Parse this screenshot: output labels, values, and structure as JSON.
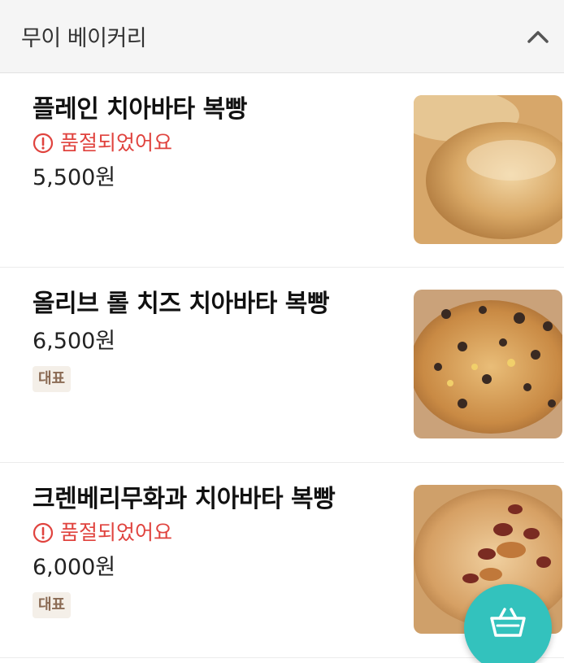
{
  "section": {
    "title": "무이 베이커리"
  },
  "items": [
    {
      "name": "플레인 치아바타 복빵",
      "soldout_text": "품절되었어요",
      "price": "5,500원"
    },
    {
      "name": "올리브 롤 치즈 치아바타 복빵",
      "price": "6,500원",
      "badge": "대표"
    },
    {
      "name": "크렌베리무화과 치아바타 복빵",
      "soldout_text": "품절되었어요",
      "price": "6,000원",
      "badge": "대표"
    }
  ],
  "colors": {
    "soldout": "#e0433e",
    "fab": "#33c2bd",
    "badge_bg": "#f4efe8",
    "badge_text": "#8b6b54"
  },
  "icons": {
    "collapse": "chevron-up-icon",
    "soldout": "exclamation-circle-icon",
    "cart": "basket-icon"
  }
}
